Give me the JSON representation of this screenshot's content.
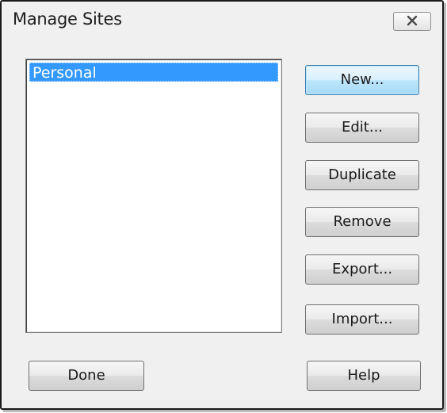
{
  "dialog": {
    "title": "Manage Sites",
    "close_icon": "close-x-icon"
  },
  "sites": {
    "items": [
      "Personal"
    ],
    "selected": "Personal"
  },
  "buttons": {
    "new_label": "New...",
    "edit_label": "Edit...",
    "duplicate_label": "Duplicate",
    "remove_label": "Remove",
    "export_label": "Export...",
    "import_label": "Import...",
    "done_label": "Done",
    "help_label": "Help"
  },
  "colors": {
    "selection": "#3399ff",
    "dialog_bg": "#f0f0f0",
    "default_button": "#bee6fd"
  }
}
